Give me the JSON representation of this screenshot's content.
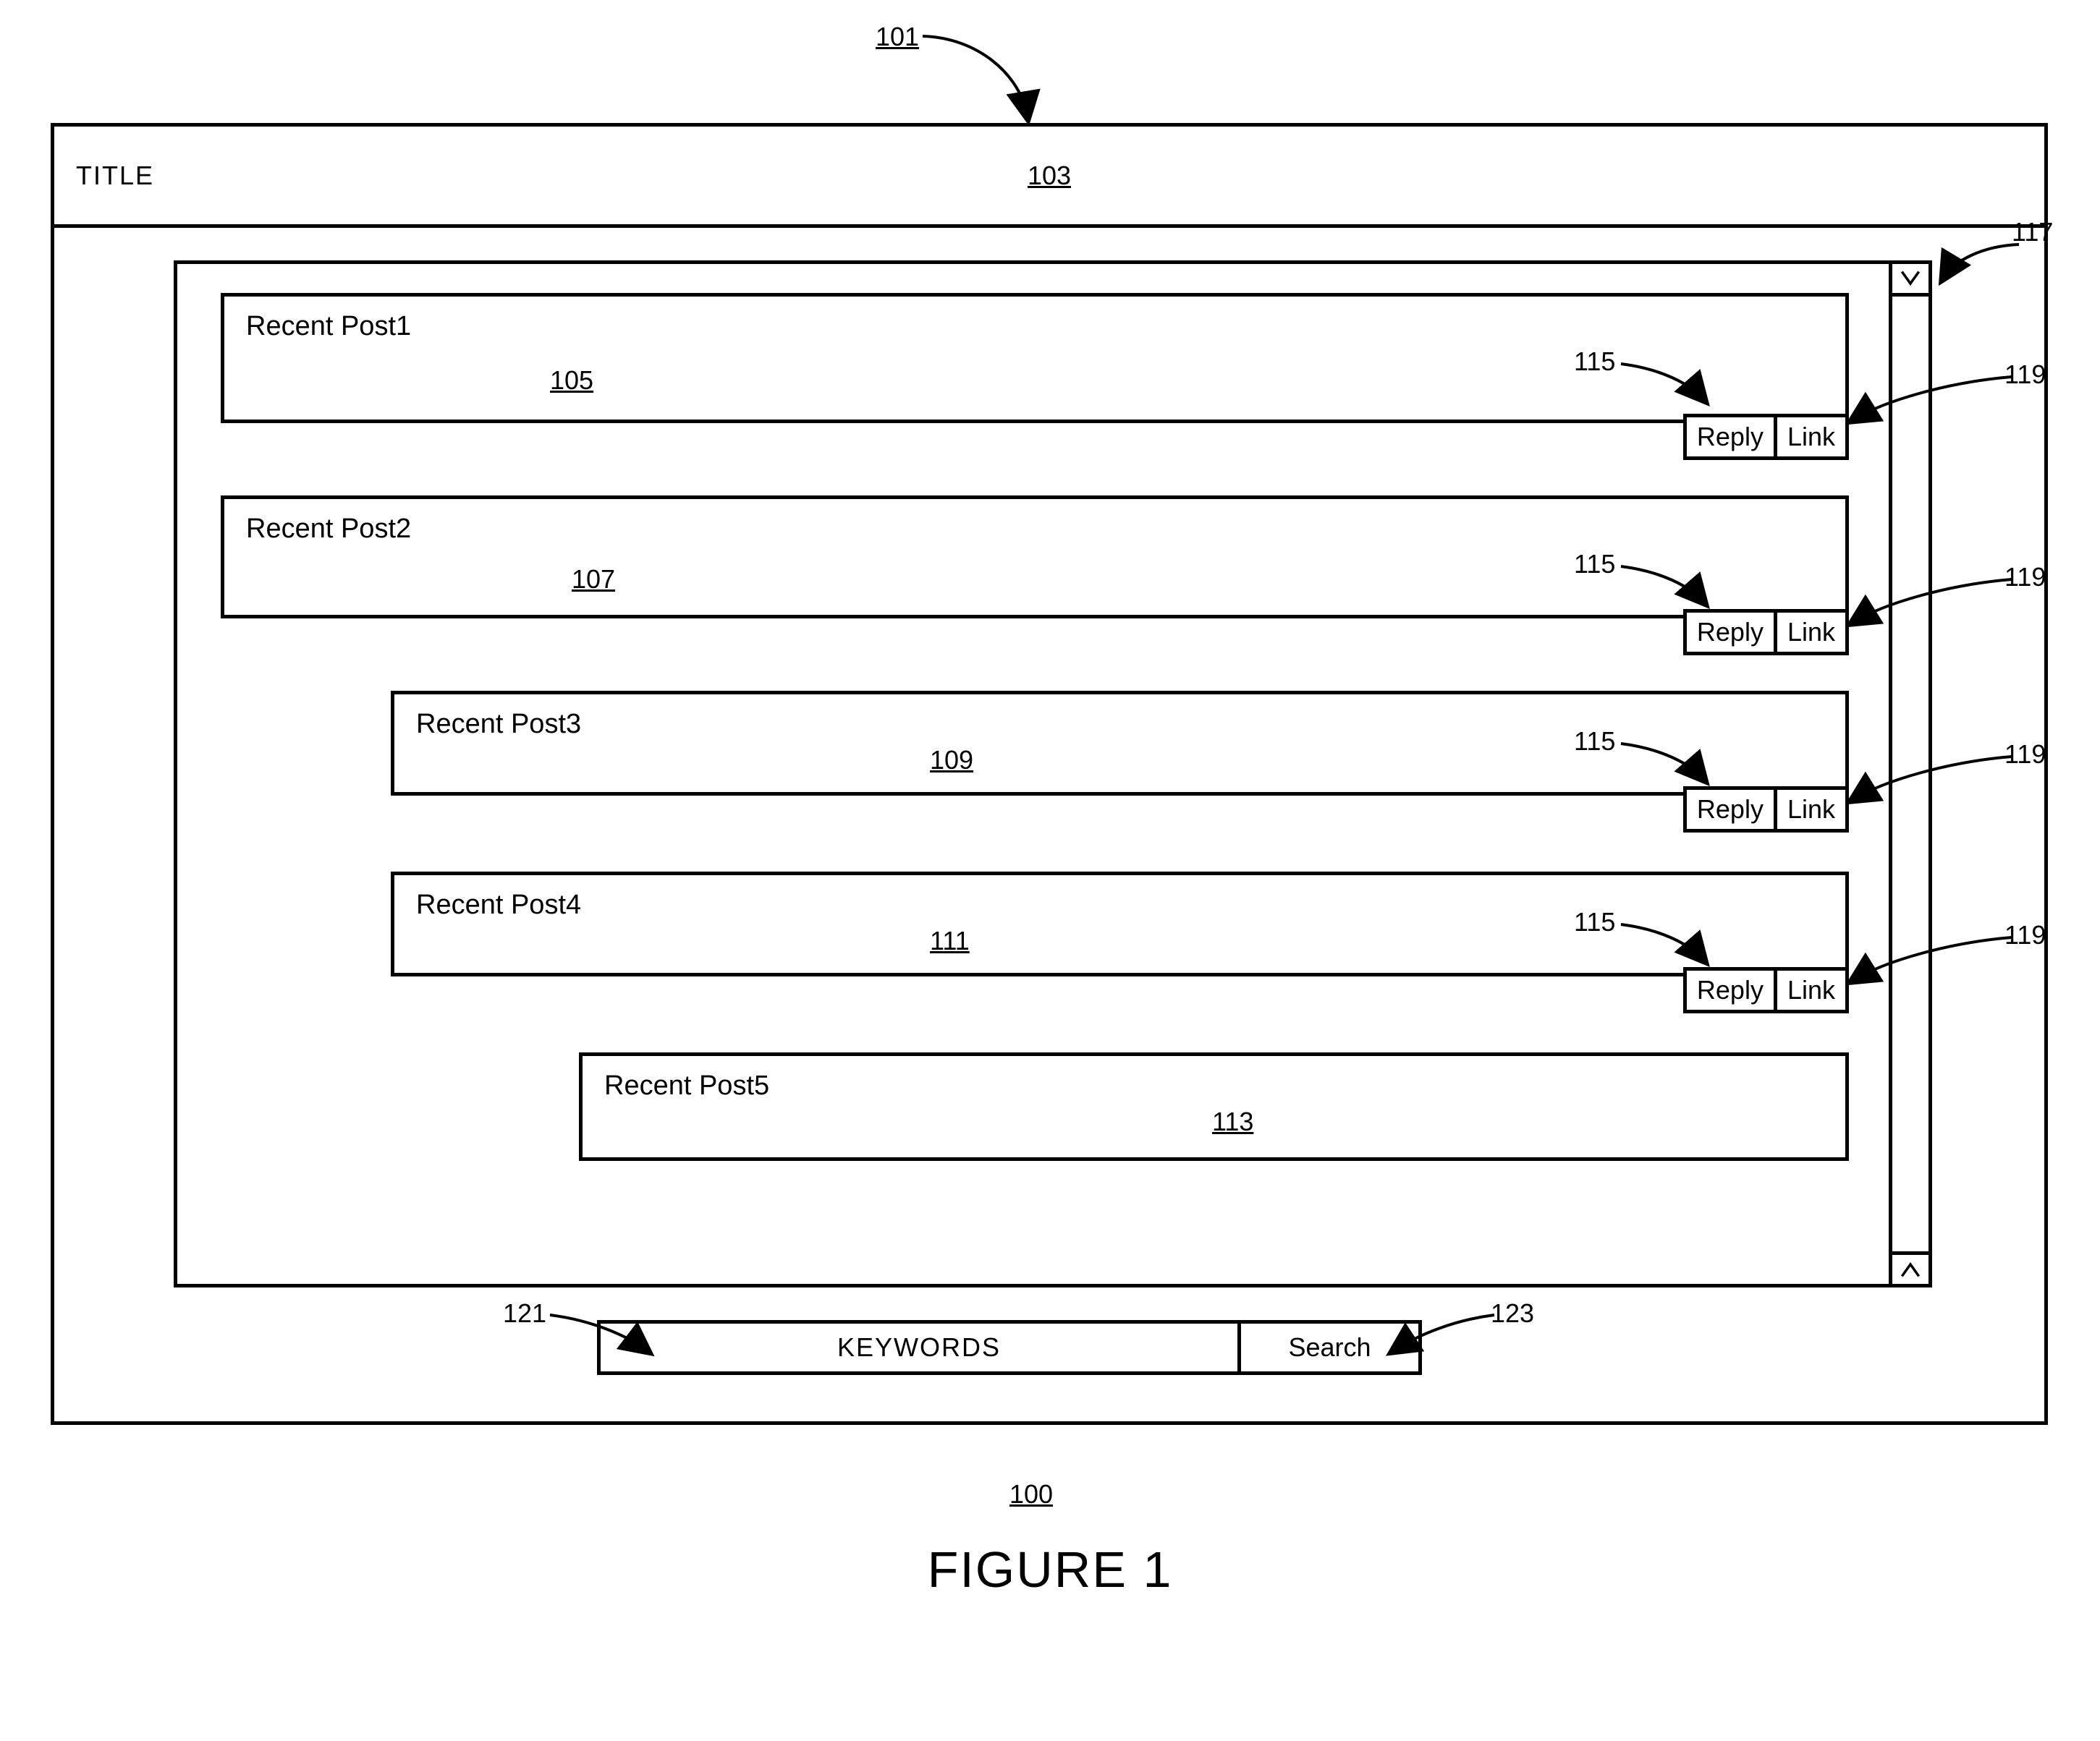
{
  "figure": {
    "number_ref": "100",
    "caption": "FIGURE 1",
    "pointer_ref": "101"
  },
  "window": {
    "title_label": "TITLE",
    "title_ref": "103",
    "scrollbar_ref": "117"
  },
  "posts": [
    {
      "title": "Recent Post1",
      "ref": "105",
      "reply_label": "Reply",
      "link_label": "Link",
      "reply_ref": "115",
      "link_ref": "119",
      "indent": 0,
      "show_actions": true
    },
    {
      "title": "Recent Post2",
      "ref": "107",
      "reply_label": "Reply",
      "link_label": "Link",
      "reply_ref": "115",
      "link_ref": "119",
      "indent": 0,
      "show_actions": true
    },
    {
      "title": "Recent Post3",
      "ref": "109",
      "reply_label": "Reply",
      "link_label": "Link",
      "reply_ref": "115",
      "link_ref": "119",
      "indent": 1,
      "show_actions": true
    },
    {
      "title": "Recent Post4",
      "ref": "111",
      "reply_label": "Reply",
      "link_label": "Link",
      "reply_ref": "115",
      "link_ref": "119",
      "indent": 1,
      "show_actions": true
    },
    {
      "title": "Recent Post5",
      "ref": "113",
      "reply_label": "Reply",
      "link_label": "Link",
      "reply_ref": "",
      "link_ref": "",
      "indent": 2,
      "show_actions": false
    }
  ],
  "search": {
    "keywords_placeholder": "KEYWORDS",
    "button_label": "Search",
    "keywords_ref": "121",
    "button_ref": "123"
  }
}
